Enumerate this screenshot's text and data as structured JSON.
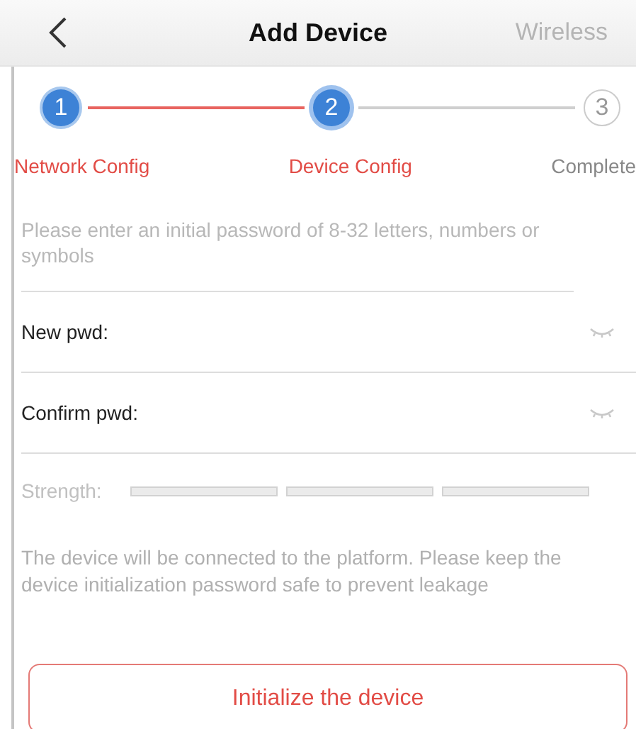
{
  "header": {
    "title": "Add Device",
    "action": {
      "label": "Wireless",
      "disabled": true
    }
  },
  "steps": [
    {
      "number": "1",
      "label": "Network Config",
      "completed": true,
      "selected": false
    },
    {
      "number": "2",
      "label": "Device Config",
      "completed": false,
      "selected": true
    },
    {
      "number": "3",
      "label": "Complete",
      "completed": false,
      "selected": false
    }
  ],
  "hint": "Please enter an initial password of 8-32 letters, numbers or symbols",
  "fields": [
    {
      "label": "New pwd:",
      "password_visible": false
    },
    {
      "label": "Confirm pwd:",
      "password_visible": false
    }
  ],
  "strength": {
    "label": "Strength:"
  },
  "notice": "The device will be connected to the platform. Please keep the device initialization password safe to prevent leakage",
  "button": "Initialize the device"
}
